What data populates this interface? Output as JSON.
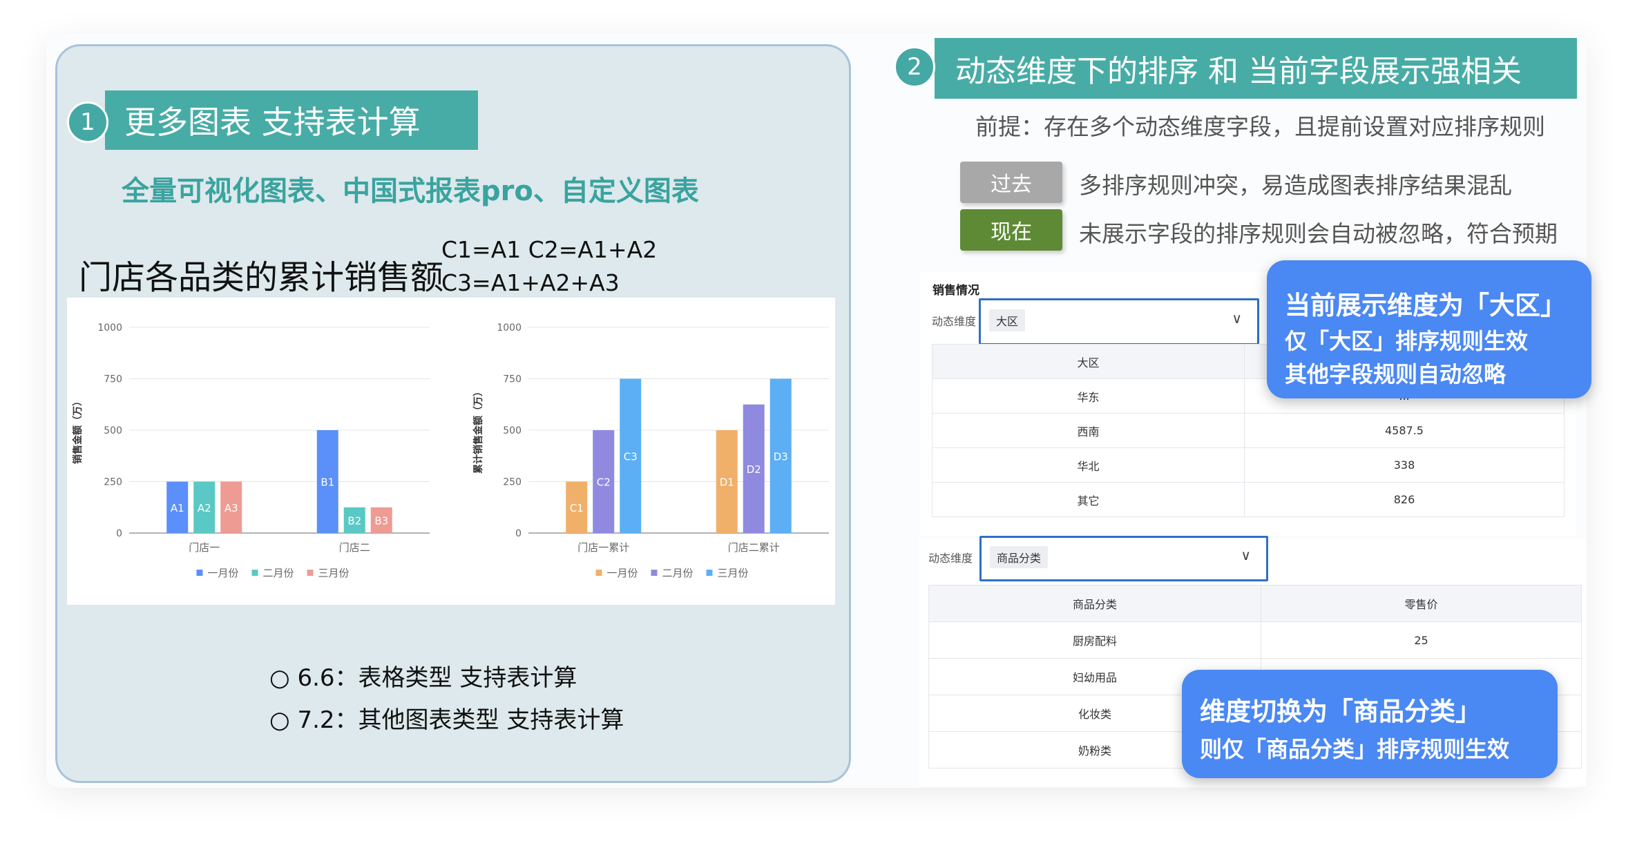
{
  "left": {
    "number": "1",
    "banner": "更多图表 支持表计算",
    "subtitle": "全量可视化图表、中国式报表pro、自定义图表",
    "chart_title": "门店各品类的累计销售额",
    "formula_line1": "C1=A1    C2=A1+A2",
    "formula_line2": "C3=A1+A2+A3",
    "bullets": [
      "○ 6.6：表格类型 支持表计算",
      "○ 7.2：其他图表类型 支持表计算"
    ]
  },
  "right": {
    "number": "2",
    "banner": "动态维度下的排序 和 当前字段展示强相关",
    "premise": "前提：存在多个动态维度字段，且提前设置对应排序规则",
    "past_tag": "过去",
    "past_text": "多排序规则冲突，易造成图表排序结果混乱",
    "now_tag": "现在",
    "now_text": "未展示字段的排序规则会自动被忽略，符合预期",
    "tag_colors": {
      "past": "#a8a8a8",
      "now": "#5e8a35"
    },
    "panel1": {
      "title": "销售情况",
      "dim_label": "动态维度",
      "dim_value": "大区",
      "chevron": "∨",
      "header": [
        "大区",
        ""
      ],
      "rows": [
        [
          "华东",
          "..."
        ],
        [
          "西南",
          "4587.5"
        ],
        [
          "华北",
          "338"
        ],
        [
          "其它",
          "826"
        ]
      ]
    },
    "panel2": {
      "dim_label": "动态维度",
      "dim_value": "商品分类",
      "chevron": "∨",
      "header": [
        "商品分类",
        "零售价"
      ],
      "rows": [
        [
          "厨房配料",
          "25"
        ],
        [
          "妇幼用品",
          ""
        ],
        [
          "化妆类",
          ""
        ],
        [
          "奶粉类",
          ""
        ]
      ]
    },
    "bubble1": {
      "line1": "当前展示维度为「大区」",
      "line2": "仅「大区」排序规则生效",
      "line3": "其他字段规则自动忽略"
    },
    "bubble2": {
      "line1": "维度切换为「商品分类」",
      "line2": "则仅「商品分类」排序规则生效"
    }
  },
  "chart_data": [
    {
      "type": "bar",
      "ylabel": "销售金额（万）",
      "ylim": [
        0,
        1000
      ],
      "yticks": [
        0,
        250,
        500,
        750,
        1000
      ],
      "categories": [
        "门店一",
        "门店二"
      ],
      "series": [
        {
          "name": "一月份",
          "color": "#5b8ff9",
          "values": [
            250,
            500
          ],
          "labels": [
            "A1",
            "B1"
          ]
        },
        {
          "name": "二月份",
          "color": "#5ac8c4",
          "values": [
            250,
            125
          ],
          "labels": [
            "A2",
            "B2"
          ]
        },
        {
          "name": "三月份",
          "color": "#ee9b94",
          "values": [
            250,
            125
          ],
          "labels": [
            "A3",
            "B3"
          ]
        }
      ],
      "legend": "bottom",
      "grid": true
    },
    {
      "type": "bar",
      "ylabel": "累计销售金额（万）",
      "ylim": [
        0,
        1000
      ],
      "yticks": [
        0,
        250,
        500,
        750,
        1000
      ],
      "categories": [
        "门店一累计",
        "门店二累计"
      ],
      "series": [
        {
          "name": "一月份",
          "color": "#f0b06a",
          "values": [
            250,
            500
          ],
          "labels": [
            "C1",
            "D1"
          ]
        },
        {
          "name": "二月份",
          "color": "#8f8ae0",
          "values": [
            500,
            625
          ],
          "labels": [
            "C2",
            "D2"
          ]
        },
        {
          "name": "三月份",
          "color": "#5caff5",
          "values": [
            750,
            750
          ],
          "labels": [
            "C3",
            "D3"
          ]
        }
      ],
      "legend": "bottom",
      "grid": true
    }
  ]
}
